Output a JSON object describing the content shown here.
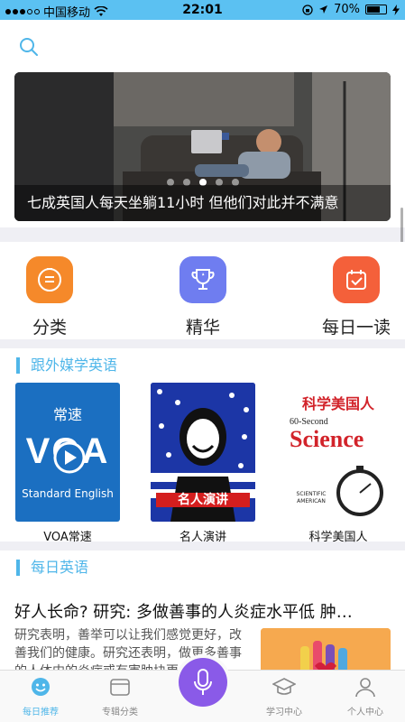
{
  "status_bar": {
    "carrier": "中国移动",
    "time": "22:01",
    "battery": "70%",
    "battery_level": 0.7
  },
  "banner": {
    "caption": "七成英国人每天坐躺11小时 但他们对此并不满意",
    "page_count": 5,
    "active_index": 2
  },
  "categories": [
    {
      "label": "分类",
      "icon": "list-icon",
      "color": "#f5892a"
    },
    {
      "label": "精华",
      "icon": "trophy-icon",
      "color": "#6f7df0"
    },
    {
      "label": "每日一读",
      "icon": "calendar-check-icon",
      "color": "#f4603a"
    }
  ],
  "section_media": {
    "title": "跟外媒学英语",
    "cards": [
      {
        "name": "VOA常速",
        "cover_top": "常速",
        "cover_logo": "VOA",
        "cover_bottom": "Standard English"
      },
      {
        "name": "名人演讲",
        "cover_banner": "名人演讲"
      },
      {
        "name": "科学美国人",
        "cover_top": "科学美国人",
        "cover_sub": "60-Second",
        "cover_main": "Science",
        "cover_foot": "SCIENTIFIC AMERICAN"
      }
    ]
  },
  "section_daily": {
    "title": "每日英语",
    "article_title": "好人长命? 研究: 多做善事的人炎症水平低 肿…",
    "article_body": "研究表明，善举可以让我们感觉更好，改善我们的健康。研究还表明，做更多善事的人体内的炎症或有害肿块更少…"
  },
  "tabbar": {
    "tabs": [
      {
        "label": "每日推荐",
        "icon": "smile-icon",
        "active": true
      },
      {
        "label": "专辑分类",
        "icon": "wallet-icon",
        "active": false
      },
      {
        "label": "学习中心",
        "icon": "graduation-cap-icon",
        "active": false
      },
      {
        "label": "个人中心",
        "icon": "user-icon",
        "active": false
      }
    ],
    "center_icon": "microphone-icon"
  },
  "colors": {
    "accent": "#4fb6e9",
    "status_bar": "#5bc1f2",
    "mic": "#8a5ae8"
  }
}
